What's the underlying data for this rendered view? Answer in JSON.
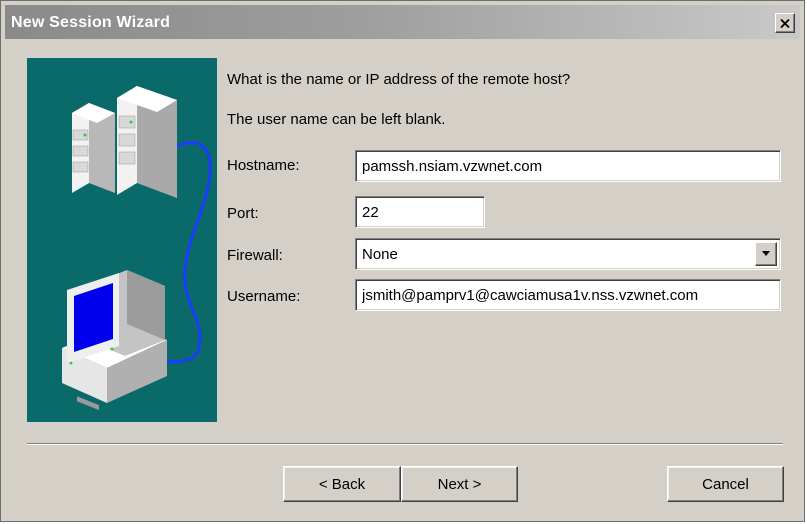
{
  "window": {
    "title": "New Session Wizard"
  },
  "prompts": {
    "line1": "What is the name or IP address of the remote host?",
    "line2": "The user name can be left blank."
  },
  "form": {
    "hostname": {
      "label": "Hostname:",
      "value": "pamssh.nsiam.vzwnet.com"
    },
    "port": {
      "label": "Port:",
      "value": "22"
    },
    "firewall": {
      "label": "Firewall:",
      "value": "None"
    },
    "username": {
      "label": "Username:",
      "value": "jsmith@pamprv1@cawciamusa1v.nss.vzwnet.com"
    }
  },
  "buttons": {
    "back": "< Back",
    "next": "Next >",
    "cancel": "Cancel"
  },
  "icons": {
    "close": "close-icon",
    "dropdown": "chevron-down-icon",
    "server": "server-icon",
    "computer": "computer-icon"
  },
  "colors": {
    "dialog_bg": "#d4d0c8",
    "illustration_bg": "#0a6a6a",
    "cable": "#1a3cff"
  }
}
